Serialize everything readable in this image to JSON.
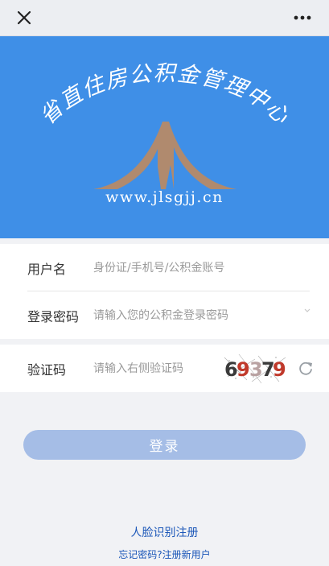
{
  "topbar": {
    "close_icon": "close-icon",
    "more_icon": "more-dots-icon"
  },
  "banner": {
    "arc_title": "省直住房公积金管理中心",
    "url": "www.jlsgjj.cn",
    "background_color": "#3f8fe7",
    "logo_color": "#b08a6e"
  },
  "form": {
    "username": {
      "label": "用户名",
      "placeholder": "身份证/手机号/公积金账号",
      "value": ""
    },
    "password": {
      "label": "登录密码",
      "placeholder": "请输入您的公积金登录密码",
      "value": ""
    },
    "captcha": {
      "label": "验证码",
      "placeholder": "请输入右侧验证码",
      "value": "",
      "code": "69379",
      "refresh_icon": "refresh-icon"
    }
  },
  "login": {
    "label": "登录",
    "color": "#a5bde6"
  },
  "links": {
    "face_register": "人脸识别注册",
    "forgot_password": "忘记密码?",
    "register_new": "注册新用户",
    "link_color": "#1a56b8"
  }
}
